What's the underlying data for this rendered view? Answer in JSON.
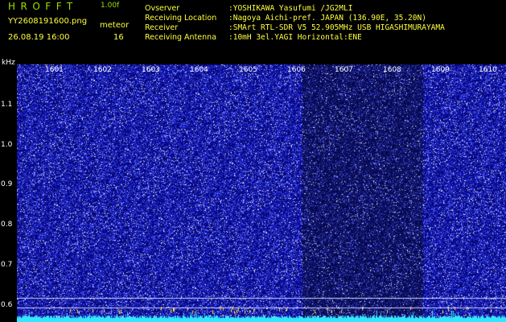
{
  "header": {
    "logo": "HROFFT",
    "version": "1.00f",
    "filename": "YY2608191600.png",
    "mode": "meteor",
    "datetime": "26.08.19 16:00",
    "count": "16",
    "info": [
      {
        "label": "Ovserver",
        "value": ":YOSHIKAWA Yasufumi /JG2MLI"
      },
      {
        "label": "Receiving Location",
        "value": ":Nagoya Aichi-pref. JAPAN (136.90E, 35.20N)"
      },
      {
        "label": "Receiver",
        "value": ":SMArt RTL-SDR V5 52.905MHz USB HIGASHIMURAYAMA"
      },
      {
        "label": "Receiving Antenna",
        "value": ":10mH 3el.YAGI Horizontal:ENE"
      }
    ]
  },
  "chart_data": {
    "type": "heatmap",
    "ylabel": "kHz",
    "y_ticks": [
      "1.1",
      "1.0",
      "0.9",
      "0.8",
      "0.7",
      "0.6"
    ],
    "x_ticks": [
      "1601",
      "1602",
      "1603",
      "1604",
      "1605",
      "1606",
      "1607",
      "1608",
      "1609",
      "1610"
    ]
  },
  "colors": {
    "noise_bg": "#0a0a78",
    "noise_speck": "#6a7aff",
    "trace": "#33e6ff",
    "logo": "#9be000",
    "text": "#ffff3c"
  }
}
